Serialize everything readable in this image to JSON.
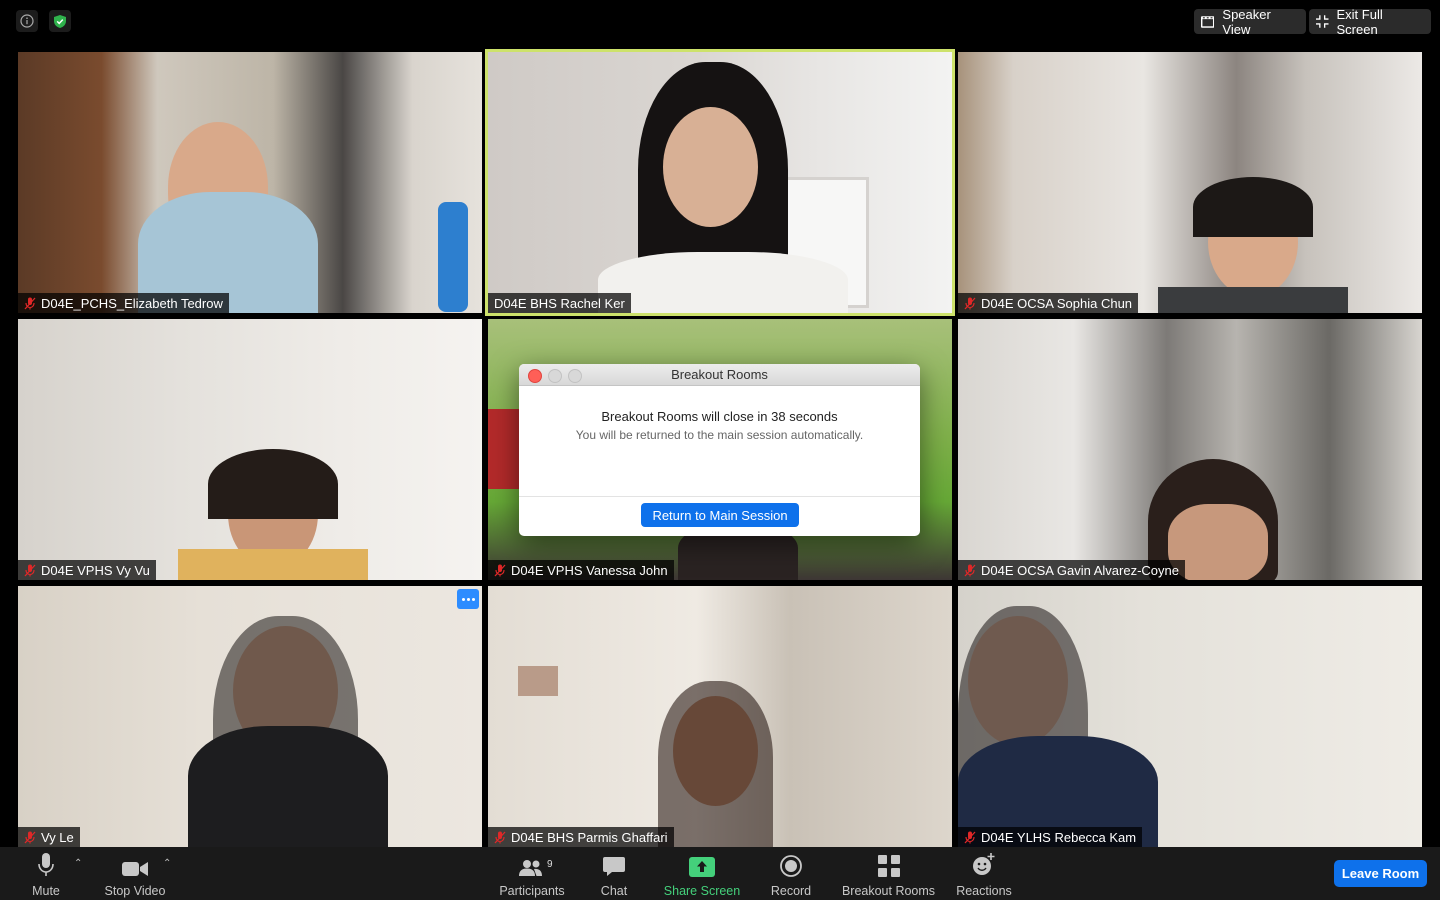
{
  "top": {
    "speaker_view": "Speaker View",
    "exit_full_screen": "Exit Full Screen"
  },
  "participants": [
    {
      "name": "D04E_PCHS_Elizabeth Tedrow",
      "muted": true
    },
    {
      "name": "D04E BHS Rachel Ker",
      "muted": false,
      "active_speaker": true
    },
    {
      "name": "D04E OCSA Sophia Chun",
      "muted": true
    },
    {
      "name": "D04E VPHS Vy Vu",
      "muted": true
    },
    {
      "name": "D04E VPHS Vanessa John",
      "muted": true
    },
    {
      "name": "D04E OCSA Gavin Alvarez-Coyne",
      "muted": true
    },
    {
      "name": "Vy Le",
      "muted": true
    },
    {
      "name": "D04E BHS Parmis Ghaffari",
      "muted": true
    },
    {
      "name": "D04E YLHS Rebecca Kam",
      "muted": true
    }
  ],
  "dialog": {
    "title": "Breakout Rooms",
    "message": "Breakout Rooms will close in 38 seconds",
    "submessage": "You will be returned to the main session automatically.",
    "button": "Return to Main Session"
  },
  "toolbar": {
    "mute": "Mute",
    "stop_video": "Stop Video",
    "participants": "Participants",
    "participants_count": "9",
    "chat": "Chat",
    "share_screen": "Share Screen",
    "record": "Record",
    "breakout_rooms": "Breakout Rooms",
    "reactions": "Reactions",
    "leave_room": "Leave Room"
  },
  "colors": {
    "active_speaker_border": "#cde26b",
    "accent_blue": "#0e71eb",
    "share_green": "#44d07b",
    "muted_red": "#e02828"
  }
}
